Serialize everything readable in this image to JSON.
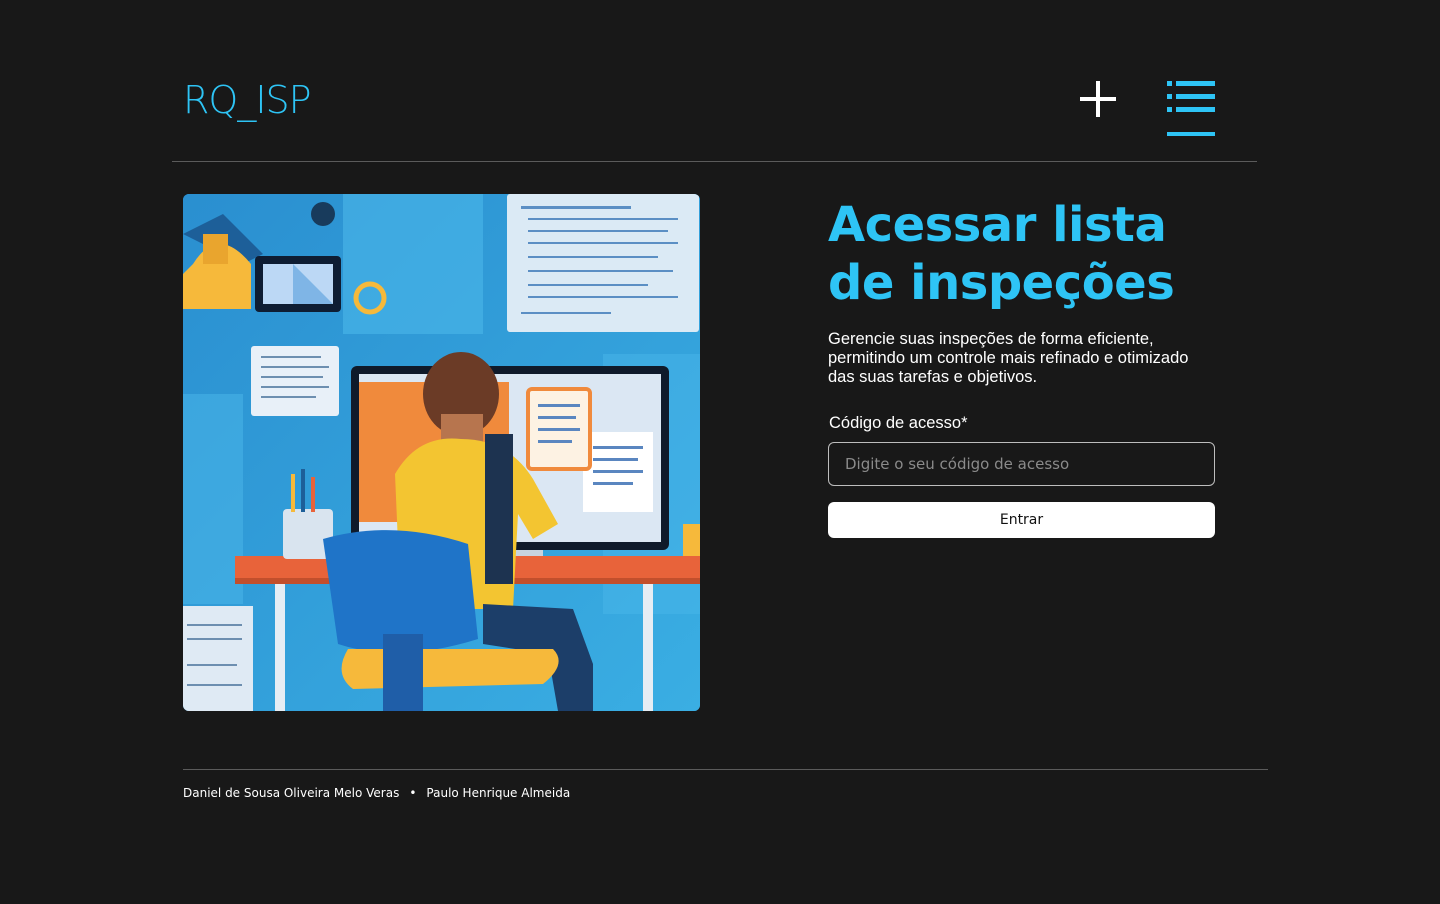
{
  "header": {
    "logo": "RQ_ISP",
    "add_icon": "plus-icon",
    "list_icon": "list-icon"
  },
  "main": {
    "illustration": "person-at-desk-reviewing-documents",
    "title": "Acessar lista de inspeções",
    "description": "Gerencie suas inspeções de forma eficiente, permitindo um controle mais refinado e otimizado das suas tarefas e objetivos.",
    "form": {
      "label": "Código de acesso*",
      "placeholder": "Digite o seu código de acesso",
      "value": "",
      "submit_label": "Entrar"
    }
  },
  "footer": {
    "authors": [
      "Daniel de Sousa Oliveira Melo Veras",
      "Paulo Henrique Almeida"
    ],
    "separator": "•"
  },
  "colors": {
    "background": "#181818",
    "accent": "#2ec4f5",
    "text": "#ffffff",
    "button_bg": "#ffffff"
  }
}
